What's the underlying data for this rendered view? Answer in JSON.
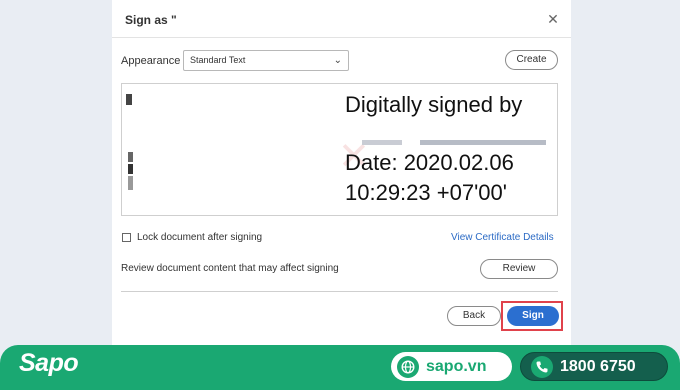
{
  "dialog": {
    "title": "Sign as \"",
    "close_glyph": "✕",
    "appearance_label": "Appearance",
    "appearance_value": "Standard Text",
    "create_label": "Create",
    "signature_preview": {
      "line1": "Digitally signed by",
      "line2": "Date: 2020.02.06",
      "line3": "10:29:23 +07'00'",
      "left_glyph": "1"
    },
    "lock_label": "Lock document after signing",
    "certificate_link": "View Certificate Details",
    "review_text": "Review document content that may affect signing",
    "review_label": "Review",
    "back_label": "Back",
    "sign_label": "Sign"
  },
  "footer": {
    "logo": "Sapo",
    "website": "sapo.vn",
    "phone": "1800 6750"
  },
  "icons": {
    "globe": "globe-icon",
    "phone": "phone-icon",
    "close": "close-icon",
    "chevron": "chevron-down-icon"
  },
  "colors": {
    "accent_blue": "#2b6fd0",
    "highlight_red": "#e0424b",
    "brand_green": "#1aa872"
  }
}
